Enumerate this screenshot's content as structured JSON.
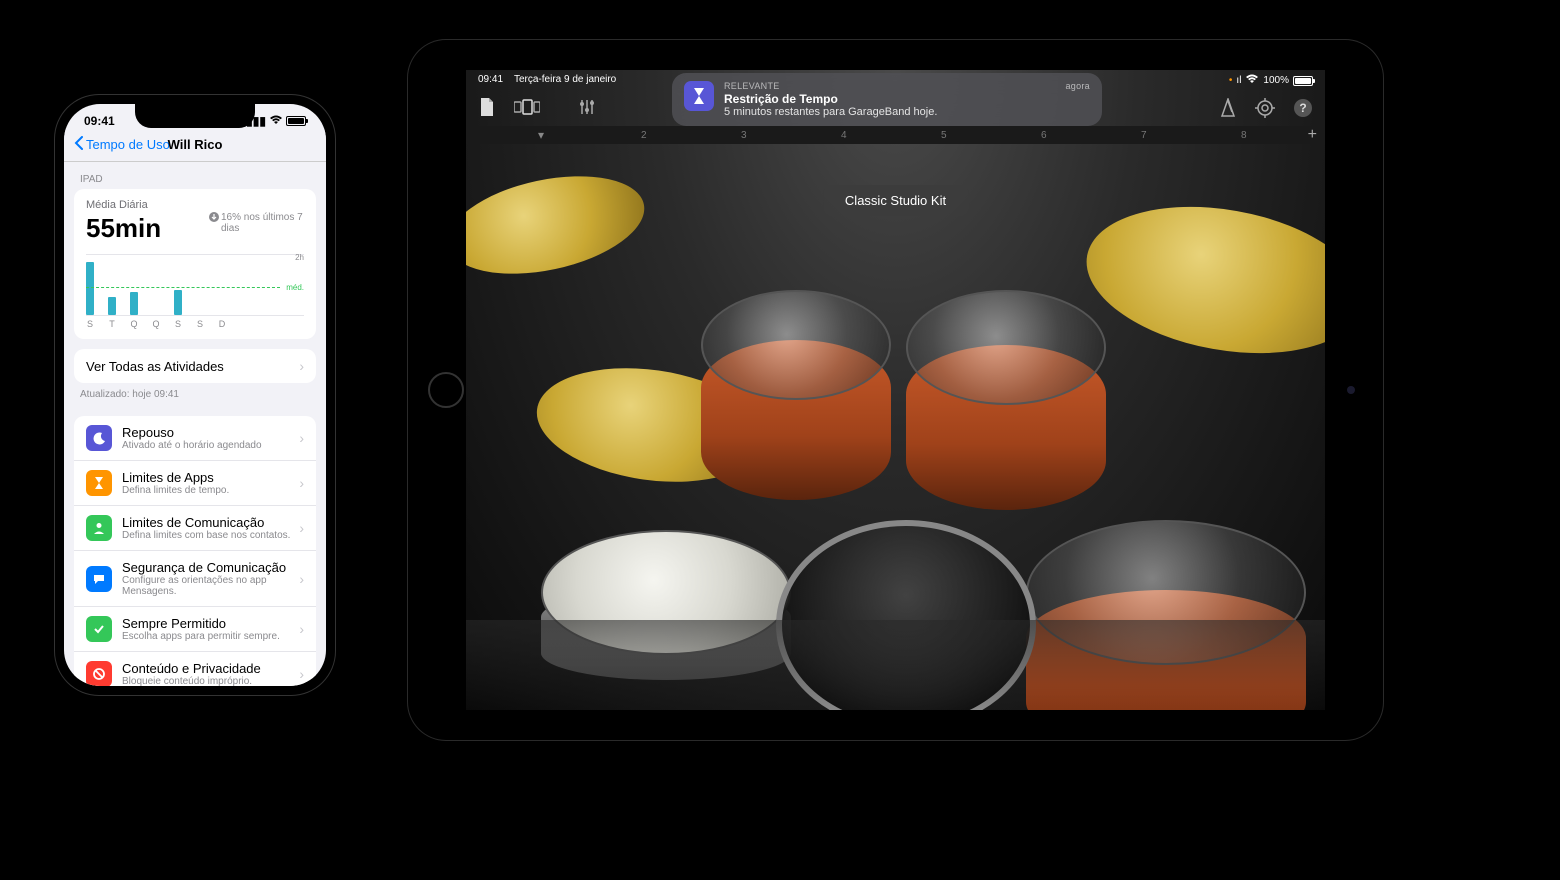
{
  "iphone": {
    "status_time": "09:41",
    "nav_back": "Tempo de Uso",
    "nav_title": "Will Rico",
    "section": "IPAD",
    "average_label": "Média Diária",
    "average_value": "55min",
    "trend_text": "16% nos últimos 7 dias",
    "chart_y_top": "2h",
    "chart_y_avg": "méd.",
    "see_all": "Ver Todas as Atividades",
    "updated": "Atualizado: hoje 09:41",
    "rows": [
      {
        "title": "Repouso",
        "sub": "Ativado até o horário agendado",
        "color": "#5856d6",
        "icon": "moon"
      },
      {
        "title": "Limites de Apps",
        "sub": "Defina limites de tempo.",
        "color": "#ff9500",
        "icon": "hourglass"
      },
      {
        "title": "Limites de Comunicação",
        "sub": "Defina limites com base nos contatos.",
        "color": "#34c759",
        "icon": "person"
      },
      {
        "title": "Segurança de Comunicação",
        "sub": "Configure as orientações no app Mensagens.",
        "color": "#007aff",
        "icon": "bubble"
      },
      {
        "title": "Sempre Permitido",
        "sub": "Escolha apps para permitir sempre.",
        "color": "#34c759",
        "icon": "check"
      },
      {
        "title": "Conteúdo e Privacidade",
        "sub": "Bloqueie conteúdo impróprio.",
        "color": "#ff3b30",
        "icon": "nosign"
      }
    ]
  },
  "chart_data": {
    "type": "bar",
    "title": "Média Diária",
    "categories": [
      "S",
      "T",
      "Q",
      "Q",
      "S",
      "S",
      "D"
    ],
    "values": [
      105,
      35,
      45,
      0,
      50,
      0,
      0
    ],
    "ylabel": "",
    "ylim": [
      0,
      120
    ],
    "average_line": 55,
    "unit": "minutes"
  },
  "ipad": {
    "status_time": "09:41",
    "status_date": "Terça-feira 9 de janeiro",
    "battery_pct": "100%",
    "notification": {
      "app_label": "RELEVANTE",
      "time": "agora",
      "title": "Restrição de Tempo",
      "body": "5 minutos restantes para GarageBand hoje."
    },
    "kit_name": "Classic Studio Kit",
    "ruler_numbers": [
      "2",
      "3",
      "4",
      "5",
      "6",
      "7",
      "8"
    ]
  }
}
